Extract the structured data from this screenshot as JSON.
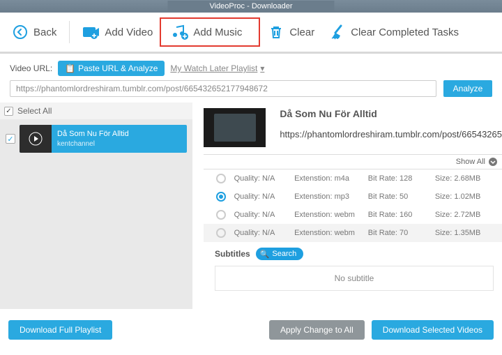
{
  "title": "VideoProc - Downloader",
  "toolbar": {
    "back": "Back",
    "add_video": "Add Video",
    "add_music": "Add Music",
    "clear": "Clear",
    "clear_completed": "Clear Completed Tasks"
  },
  "url": {
    "label": "Video URL:",
    "paste_btn": "Paste URL & Analyze",
    "watch_later": "My Watch Later Playlist",
    "value": "https://phantomlordreshiram.tumblr.com/post/665432652177948672",
    "analyze": "Analyze"
  },
  "selectall": "Select All",
  "playlist": {
    "title": "Då Som Nu För Alltid",
    "channel": "kentchannel"
  },
  "detail": {
    "title": "Då Som Nu För Alltid",
    "url": "https://phantomlordreshiram.tumblr.com/post/66543265"
  },
  "showall": "Show All",
  "formats": [
    {
      "quality": "Quality: N/A",
      "ext": "Extenstion: m4a",
      "bitrate": "Bit Rate: 128",
      "size": "Size: 2.68MB",
      "selected": false,
      "alt": false
    },
    {
      "quality": "Quality: N/A",
      "ext": "Extenstion: mp3",
      "bitrate": "Bit Rate: 50",
      "size": "Size: 1.02MB",
      "selected": true,
      "alt": false
    },
    {
      "quality": "Quality: N/A",
      "ext": "Extenstion: webm",
      "bitrate": "Bit Rate: 160",
      "size": "Size: 2.72MB",
      "selected": false,
      "alt": false
    },
    {
      "quality": "Quality: N/A",
      "ext": "Extenstion: webm",
      "bitrate": "Bit Rate: 70",
      "size": "Size: 1.35MB",
      "selected": false,
      "alt": true
    }
  ],
  "subtitles_label": "Subtitles",
  "search_label": "Search",
  "no_subtitle": "No subtitle",
  "footer": {
    "full": "Download Full Playlist",
    "apply": "Apply Change to All",
    "selected": "Download Selected Videos"
  }
}
